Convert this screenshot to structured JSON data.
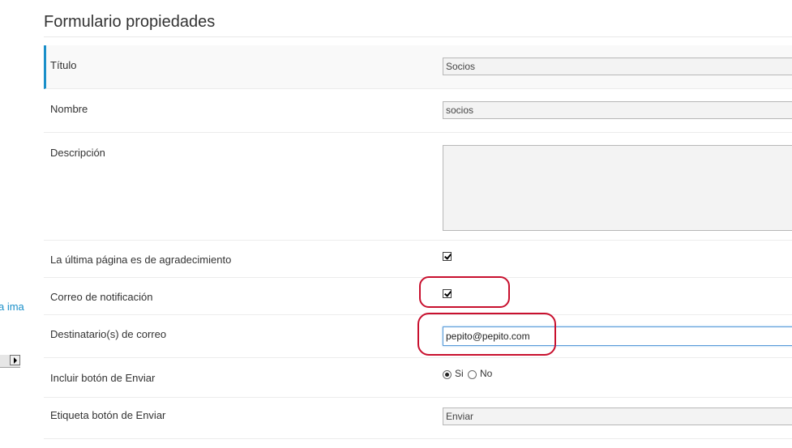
{
  "page": {
    "title": "Formulario propiedades"
  },
  "left_panel": {
    "partial_text": "a ima"
  },
  "form": {
    "titulo": {
      "label": "Título",
      "value": "Socios"
    },
    "nombre": {
      "label": "Nombre",
      "value": "socios"
    },
    "descripcion": {
      "label": "Descripción",
      "value": ""
    },
    "agradecimiento": {
      "label": "La última página es de agradecimiento",
      "checked": true
    },
    "correo_notificacion": {
      "label": "Correo de notificación",
      "checked": true
    },
    "destinatarios": {
      "label": "Destinatario(s) de correo",
      "value": "pepito@pepito.com"
    },
    "incluir_boton": {
      "label": "Incluir botón de Enviar",
      "option_si": "Si",
      "option_no": "No",
      "selected": "Si"
    },
    "etiqueta_boton": {
      "label": "Etiqueta botón de Enviar",
      "value": "Enviar"
    }
  },
  "colors": {
    "accent": "#1a8fc9",
    "annotation": "#c8102e"
  }
}
